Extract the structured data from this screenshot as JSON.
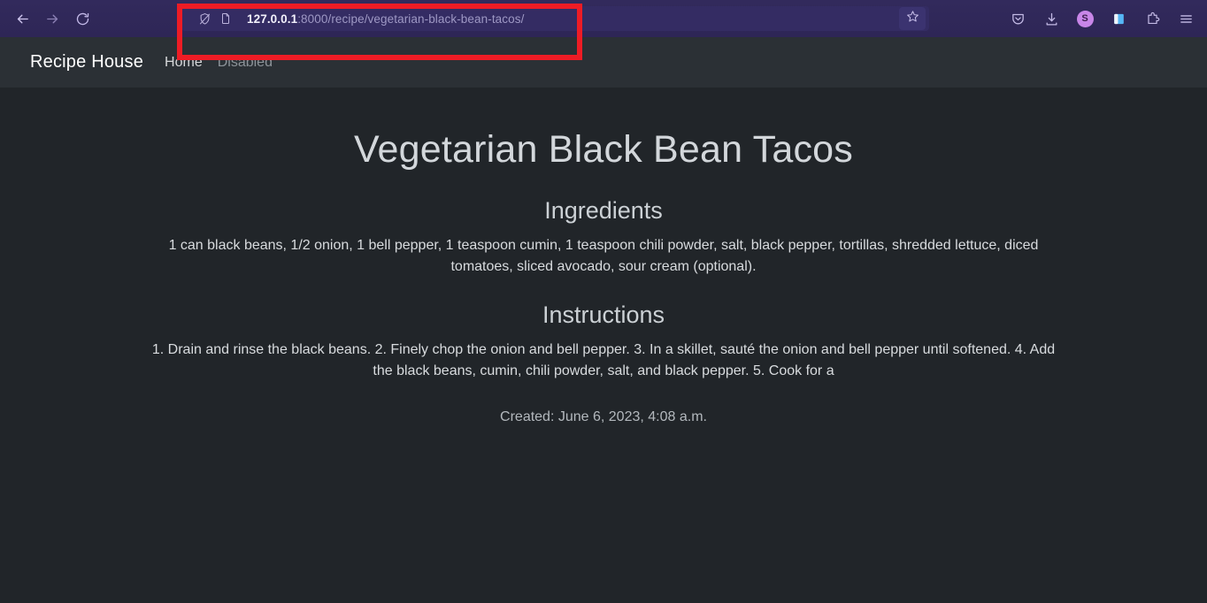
{
  "browser": {
    "back_icon": "back-arrow-icon",
    "forward_icon": "forward-arrow-icon",
    "reload_icon": "reload-icon",
    "shield_icon": "shield-off-icon",
    "page_icon": "page-document-icon",
    "url_host": "127.0.0.1",
    "url_path": ":8000/recipe/vegetarian-black-bean-tacos/",
    "url_full": "127.0.0.1:8000/recipe/vegetarian-black-bean-tacos/",
    "star_icon": "bookmark-star-icon",
    "toolbar_icons": [
      "pocket-icon",
      "downloads-icon",
      "account-avatar-icon",
      "firefox-view-icon",
      "extensions-puzzle-icon",
      "application-menu-icon"
    ],
    "avatar_initial": "S",
    "accent_color": "#c886e8",
    "chrome_color": "#2e2656",
    "urlbar_color": "#342c63"
  },
  "navbar": {
    "brand": "Recipe House",
    "links": [
      {
        "label": "Home",
        "state": "active"
      },
      {
        "label": "Disabled",
        "state": "disabled"
      }
    ]
  },
  "page": {
    "title": "Vegetarian Black Bean Tacos",
    "sections": [
      {
        "heading": "Ingredients",
        "text": "1 can black beans, 1/2 onion, 1 bell pepper, 1 teaspoon cumin, 1 teaspoon chili powder, salt, black pepper, tortillas, shredded lettuce, diced tomatoes, sliced avocado, sour cream (optional)."
      },
      {
        "heading": "Instructions",
        "text": "1. Drain and rinse the black beans. 2. Finely chop the onion and bell pepper. 3. In a skillet, sauté the onion and bell pepper until softened. 4. Add the black beans, cumin, chili powder, salt, and black pepper. 5. Cook for a"
      }
    ],
    "created": "Created: June 6, 2023, 4:08 a.m.",
    "background_color": "#212529",
    "navbar_color": "#2b3035"
  },
  "annotation": {
    "type": "highlight-rectangle",
    "color": "#ee1c25",
    "target": "address-bar"
  }
}
